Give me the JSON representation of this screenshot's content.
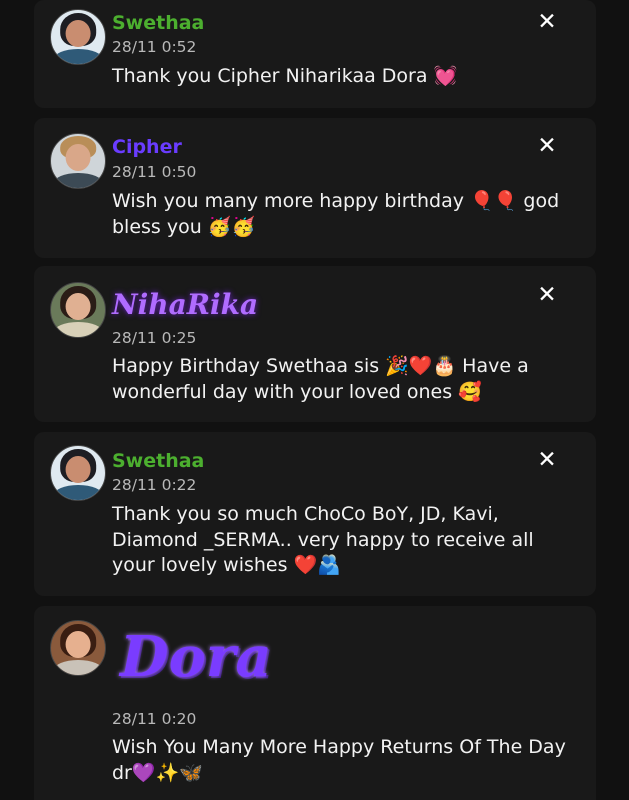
{
  "messages": [
    {
      "name": "Swethaa",
      "name_color": "#4caf2f",
      "time": "28/11 0:52",
      "text": "Thank you Cipher Niharikaa Dora 💓",
      "avatar": "woman-avatar"
    },
    {
      "name": "Cipher",
      "name_color": "#6a3cff",
      "time": "28/11 0:50",
      "text": "Wish you many more happy birthday 🎈🎈 god bless you 🥳🥳",
      "avatar": "man-avatar"
    },
    {
      "name": "NihaRika",
      "name_color": "#b06cff",
      "time": "28/11 0:25",
      "text": "Happy Birthday Swethaa sis 🎉❤️🎂 Have a wonderful day with your loved ones 🥰",
      "avatar": "woman-avatar"
    },
    {
      "name": "Swethaa",
      "name_color": "#4caf2f",
      "time": "28/11 0:22",
      "text": "Thank you so much ChoCo BoY, JD, Kavi, Diamond _SERMA.. very happy to receive all your lovely wishes ❤️🫂",
      "avatar": "woman-avatar"
    },
    {
      "name": "Dora",
      "name_color": "#7a3cff",
      "time": "28/11 0:20",
      "text": "Wish You Many More Happy Returns Of The Day dr💜✨🦋",
      "avatar": "woman-avatar"
    }
  ],
  "close_icon": "close-icon"
}
